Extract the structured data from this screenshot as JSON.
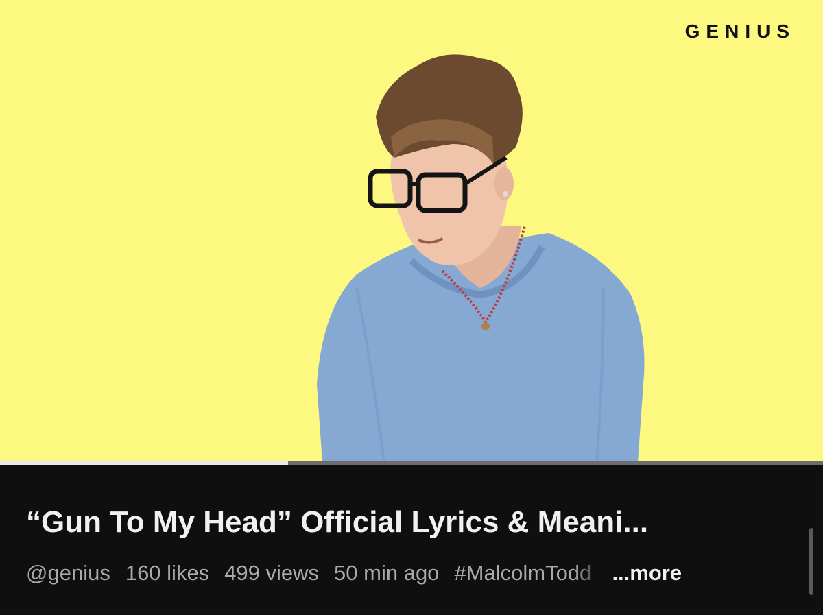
{
  "player": {
    "brand_logo_text": "GENIUS",
    "background_color": "#fdf87f",
    "progress_fraction": 0.35
  },
  "video": {
    "title": "“Gun To My Head” Official Lyrics & Meani...",
    "channel": "@genius",
    "likes": "160 likes",
    "views": "499 views",
    "posted": "50 min ago",
    "hashtag": "#MalcolmTodd",
    "more_label": "...more"
  }
}
